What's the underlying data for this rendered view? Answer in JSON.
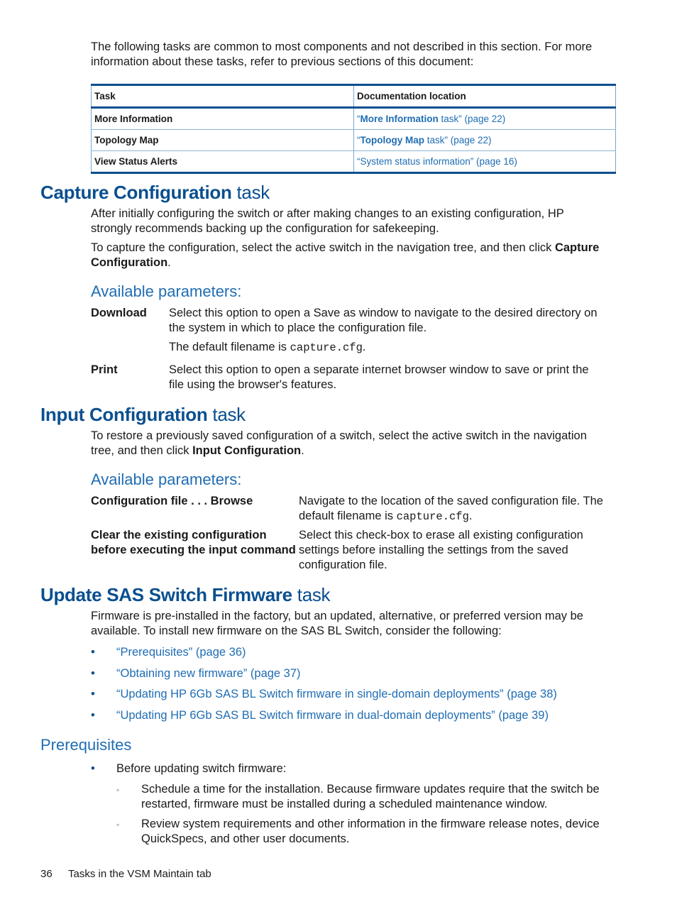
{
  "intro": {
    "line1": "The following tasks are common to most components and not described in this section. For more",
    "line2": "information about these tasks, refer to previous sections of this document:"
  },
  "table": {
    "headers": [
      "Task",
      "Documentation location"
    ],
    "rows": [
      {
        "task": "More Information",
        "link_bold": "More Information",
        "link_rest": " task” (page 22)"
      },
      {
        "task": "Topology Map",
        "link_bold": "Topology Map",
        "link_rest": " task” (page 22)"
      },
      {
        "task": "View Status Alerts",
        "link_bold": "",
        "link_rest": "System status information” (page 16)"
      }
    ],
    "open_quote": "“"
  },
  "capture": {
    "title_strong": "Capture Configuration",
    "title_rest": " task",
    "p1_line1": "After initially configuring the switch or after making changes to an existing configuration, HP",
    "p1_line2": "strongly recommends backing up the configuration for safekeeping.",
    "p2_line1": "To capture the configuration, select the active switch in the navigation tree, and then click ",
    "p2_bold1": "Capture",
    "p2_bold2": "Configuration",
    "p2_end": ".",
    "params_heading": "Available parameters:",
    "params": [
      {
        "term": "Download",
        "line1": "Select this option to open a Save as window to navigate to the desired directory on",
        "line2": "the system in which to place the configuration file.",
        "note_prefix": "The default filename is ",
        "note_code": "capture.cfg",
        "note_suffix": "."
      },
      {
        "term": "Print",
        "line1": "Select this option to open a separate internet browser window to save or print the",
        "line2": "file using the browser's features."
      }
    ]
  },
  "input": {
    "title_strong": "Input Configuration",
    "title_rest": " task",
    "p1_line1": "To restore a previously saved configuration of a switch, select the active switch in the navigation",
    "p1_line2_prefix": "tree, and then click ",
    "p1_bold": "Input Configuration",
    "p1_end": ".",
    "params_heading": "Available parameters:",
    "params": [
      {
        "term": "Configuration file . . . Browse",
        "line1": "Navigate to the location of the saved configuration file. The",
        "line2_prefix": "default filename is ",
        "line2_code": "capture.cfg",
        "line2_suffix": "."
      },
      {
        "term_line1": "Clear the existing configuration",
        "term_line2": "before executing the input command",
        "line1": "Select this check-box to erase all existing configuration",
        "line2": "settings before installing the settings from the saved",
        "line3": "configuration file."
      }
    ]
  },
  "firmware": {
    "title_strong": "Update SAS Switch Firmware",
    "title_rest": " task",
    "p1_line1": "Firmware is pre-installed in the factory, but an updated, alternative, or preferred version may be",
    "p1_line2": "available. To install new firmware on the SAS BL Switch, consider the following:",
    "links": [
      "“Prerequisites” (page 36)",
      "“Obtaining new firmware” (page 37)",
      "“Updating HP 6Gb SAS BL Switch firmware in single-domain deployments” (page 38)",
      "“Updating HP 6Gb SAS BL Switch firmware in dual-domain deployments” (page 39)"
    ],
    "bullet_glyph": "•"
  },
  "prereq": {
    "heading": "Prerequisites",
    "bullet": "Before updating switch firmware:",
    "sub_glyph": "◦",
    "sub": [
      {
        "line1": "Schedule a time for the installation. Because firmware updates require that the switch be",
        "line2": "restarted, firmware must be installed during a scheduled maintenance window."
      },
      {
        "line1": "Review system requirements and other information in the firmware release notes, device",
        "line2": "QuickSpecs, and other user documents."
      }
    ]
  },
  "footer": {
    "page_number": "36",
    "section": "Tasks in the VSM Maintain tab"
  }
}
